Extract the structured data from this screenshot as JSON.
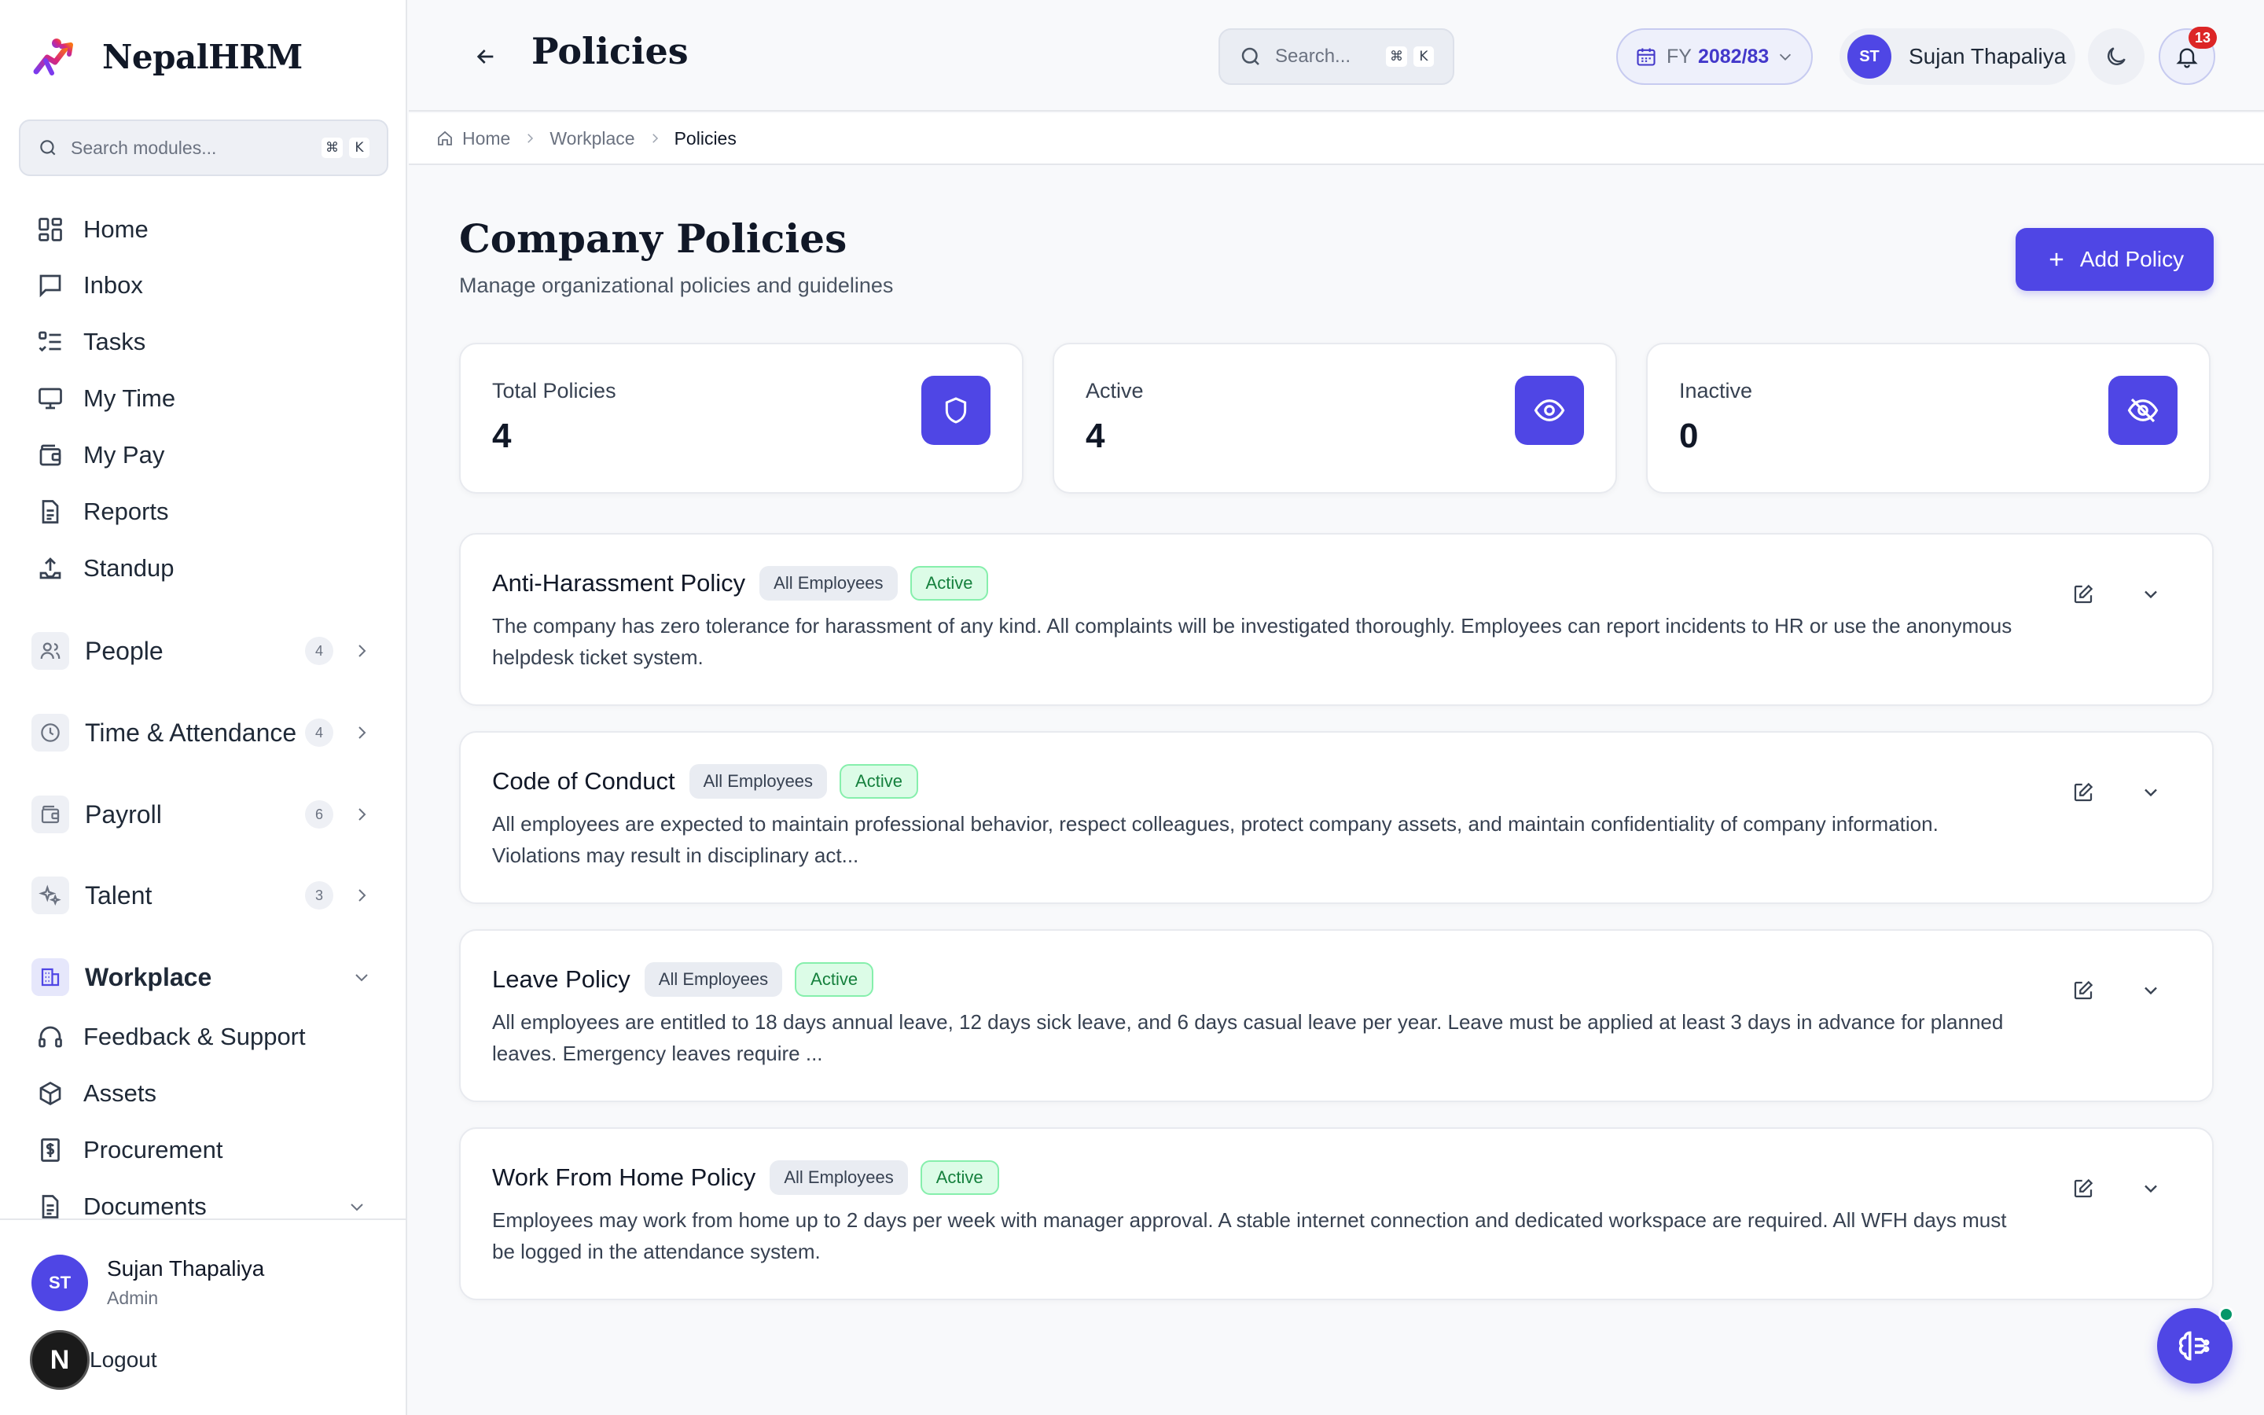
{
  "app": {
    "name": "NepalHRM",
    "colors": {
      "accent": "#4f46e5",
      "active_green": "#15803d",
      "notif_red": "#dc2626"
    }
  },
  "sidebar": {
    "search_placeholder": "Search modules...",
    "shortcut": [
      "⌘",
      "K"
    ],
    "nav": [
      {
        "label": "Home",
        "icon": "grid-icon"
      },
      {
        "label": "Inbox",
        "icon": "message-icon"
      },
      {
        "label": "Tasks",
        "icon": "checklist-icon"
      },
      {
        "label": "My Time",
        "icon": "monitor-icon"
      },
      {
        "label": "My Pay",
        "icon": "wallet-icon"
      },
      {
        "label": "Reports",
        "icon": "document-icon"
      },
      {
        "label": "Standup",
        "icon": "upload-icon"
      }
    ],
    "groups": [
      {
        "label": "People",
        "count": "4",
        "icon": "users-icon"
      },
      {
        "label": "Time & Attendance",
        "count": "4",
        "icon": "clock-icon"
      },
      {
        "label": "Payroll",
        "count": "6",
        "icon": "wallet-icon"
      },
      {
        "label": "Talent",
        "count": "3",
        "icon": "sparkle-icon"
      },
      {
        "label": "Workplace",
        "icon": "building-icon"
      }
    ],
    "workplace_items": [
      {
        "label": "Feedback & Support",
        "icon": "headset-icon"
      },
      {
        "label": "Assets",
        "icon": "box-icon"
      },
      {
        "label": "Procurement",
        "icon": "dollar-doc-icon"
      },
      {
        "label": "Documents",
        "icon": "document-icon"
      }
    ],
    "user": {
      "initials": "ST",
      "name": "Sujan Thapaliya",
      "role": "Admin"
    },
    "logout_label": "Logout",
    "n_badge": "N"
  },
  "topbar": {
    "title": "Policies",
    "search_placeholder": "Search...",
    "shortcut": [
      "⌘",
      "K"
    ],
    "fy_prefix": "FY",
    "fy_value": "2082/83",
    "user_initials": "ST",
    "user_name": "Sujan Thapaliya",
    "notification_count": "13"
  },
  "breadcrumb": [
    "Home",
    "Workplace",
    "Policies"
  ],
  "main": {
    "heading": "Company Policies",
    "subheading": "Manage organizational policies and guidelines",
    "add_button": "Add Policy",
    "stats": [
      {
        "label": "Total Policies",
        "value": "4",
        "icon": "shield-icon"
      },
      {
        "label": "Active",
        "value": "4",
        "icon": "eye-icon"
      },
      {
        "label": "Inactive",
        "value": "0",
        "icon": "eye-off-icon"
      }
    ],
    "policies": [
      {
        "title": "Anti-Harassment Policy",
        "audience": "All Employees",
        "status": "Active",
        "description": "The company has zero tolerance for harassment of any kind. All complaints will be investigated thoroughly. Employees can report incidents to HR or use the anonymous helpdesk ticket system."
      },
      {
        "title": "Code of Conduct",
        "audience": "All Employees",
        "status": "Active",
        "description": "All employees are expected to maintain professional behavior, respect colleagues, protect company assets, and maintain confidentiality of company information. Violations may result in disciplinary act..."
      },
      {
        "title": "Leave Policy",
        "audience": "All Employees",
        "status": "Active",
        "description": "All employees are entitled to 18 days annual leave, 12 days sick leave, and 6 days casual leave per year. Leave must be applied at least 3 days in advance for planned leaves. Emergency leaves require ..."
      },
      {
        "title": "Work From Home Policy",
        "audience": "All Employees",
        "status": "Active",
        "description": "Employees may work from home up to 2 days per week with manager approval. A stable internet connection and dedicated workspace are required. All WFH days must be logged in the attendance system."
      }
    ]
  }
}
